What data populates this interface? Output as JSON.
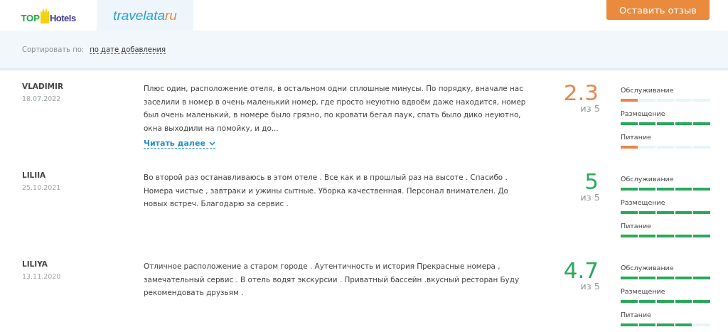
{
  "tabs": [
    {
      "kind": "tophotels",
      "label_a": "TOP",
      "label_b": "Hotels",
      "selected": false
    },
    {
      "kind": "travelata",
      "label_a": "travelata",
      "label_b": "ru",
      "selected": true
    }
  ],
  "review_button": "Оставить отзыв",
  "sort": {
    "label": "Сортировать по:",
    "value": "по дате добавления"
  },
  "reviews": [
    {
      "name": "VLADIMIR",
      "date": "18.07.2022",
      "text": "Плюс один, расположение отеля, в остальном одни сплошные минусы. По порядку, вначале нас заселили в номер в очень маленький номер, где просто неуютно вдвоём даже находится, номер был очень маленький, в номере было грязно, по кровати бегал паук, спать было дико неуютно, окна выходили на помойку, и до...",
      "read_more": "Читать далее",
      "score": "2.3",
      "out_of": "из 5",
      "color": "#e8874a",
      "ratings": [
        {
          "label": "Обслуживание",
          "stars": 1
        },
        {
          "label": "Размещение",
          "stars": 5
        },
        {
          "label": "Питание",
          "stars": 1
        }
      ]
    },
    {
      "name": "LILIIA",
      "date": "25.10.2021",
      "text": "Во второй раз останавливаюсь в этом отеле . Все как и в прошлый раз на высоте . Спасибо . Номера чистые , завтраки и ужины сытные. Уборка качественная. Персонал внимателен. До новых встреч. Благодарю за сервис .",
      "score": "5",
      "out_of": "из 5",
      "color": "#2aa85c",
      "ratings": [
        {
          "label": "Обслуживание",
          "stars": 5
        },
        {
          "label": "Размещение",
          "stars": 5
        },
        {
          "label": "Питание",
          "stars": 5
        }
      ]
    },
    {
      "name": "LILIYA",
      "date": "13.11.2020",
      "text": "Отличное расположение а старом городе . Аутентичность и история Прекрасные номера , замечательный сервис . В отель водят экскурсии . Приватный бассейн .вкусный ресторан Буду рекомендовать друзьям .",
      "score": "4.7",
      "out_of": "из 5",
      "color": "#2aa85c",
      "ratings": [
        {
          "label": "Обслуживание",
          "stars": 5
        },
        {
          "label": "Размещение",
          "stars": 5
        },
        {
          "label": "Питание",
          "stars": 4
        }
      ]
    }
  ]
}
